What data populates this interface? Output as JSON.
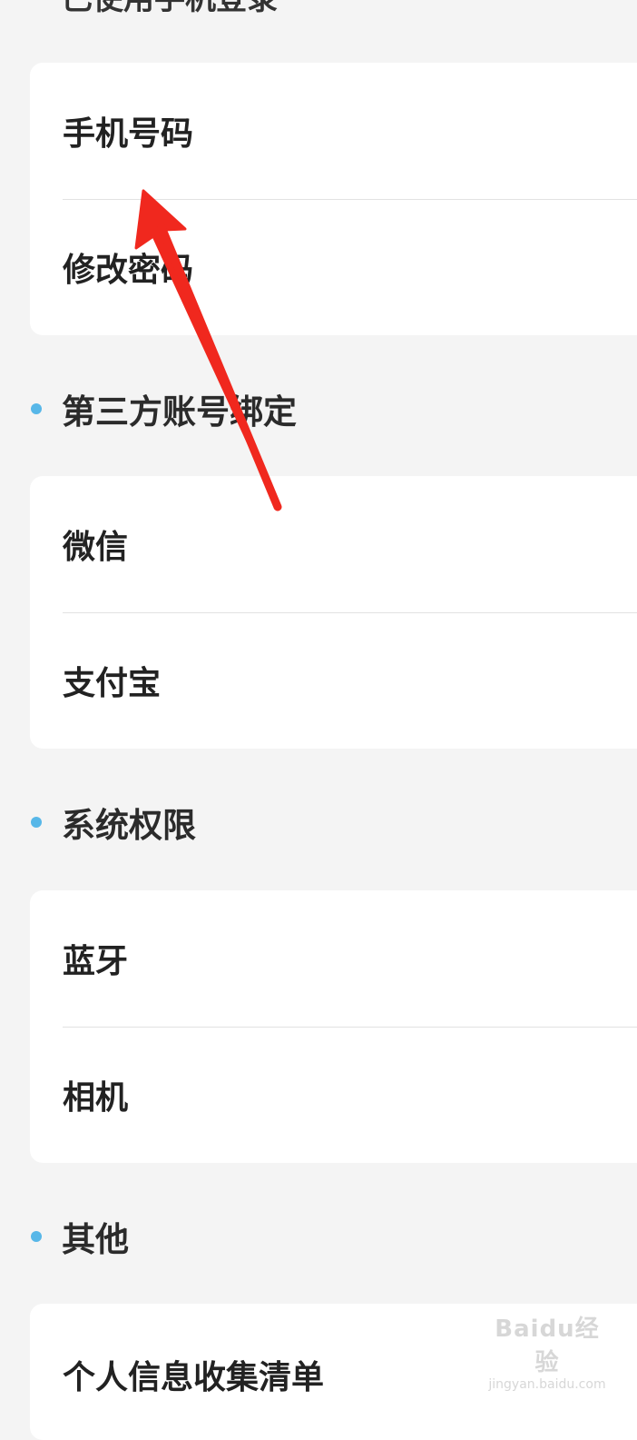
{
  "top_heading": "已使用手机登录",
  "sections": {
    "account": {
      "items": [
        {
          "label": "手机号码"
        },
        {
          "label": "修改密码"
        }
      ]
    },
    "third_party": {
      "title": "第三方账号绑定",
      "items": [
        {
          "label": "微信"
        },
        {
          "label": "支付宝"
        }
      ]
    },
    "system_permissions": {
      "title": "系统权限",
      "items": [
        {
          "label": "蓝牙"
        },
        {
          "label": "相机"
        }
      ]
    },
    "others": {
      "title": "其他",
      "items": [
        {
          "label": "个人信息收集清单"
        }
      ]
    }
  },
  "colors": {
    "background": "#f4f4f4",
    "card": "#ffffff",
    "bullet": "#57b7e8",
    "annotation_arrow": "#f0281e"
  },
  "icons": {
    "section_bullet": "bullet-dot",
    "annotation": "red-arrow-icon"
  },
  "watermark": {
    "logo": "Baidu经验",
    "url": "jingyan.baidu.com"
  }
}
